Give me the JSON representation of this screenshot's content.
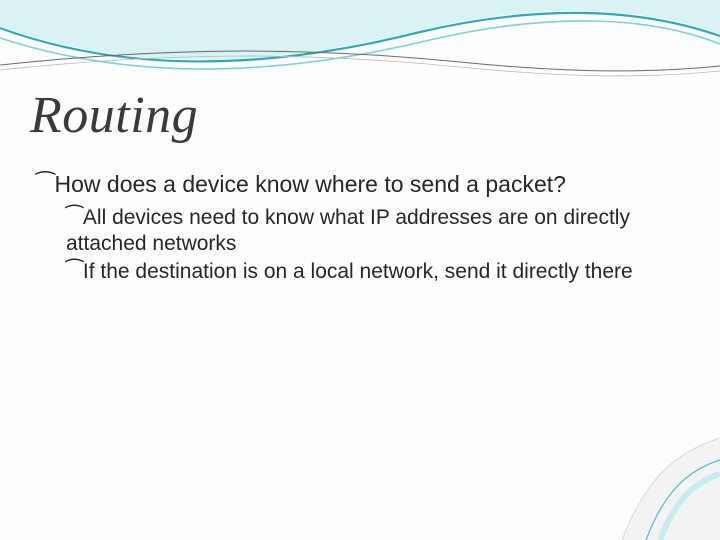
{
  "title": "Routing",
  "bullets": {
    "q": "How does a device know where to send a packet?",
    "sub1": "All devices need to know what IP addresses are on directly attached networks",
    "sub2": "If the destination is on a local network, send it directly there"
  },
  "glyph": "⁀"
}
